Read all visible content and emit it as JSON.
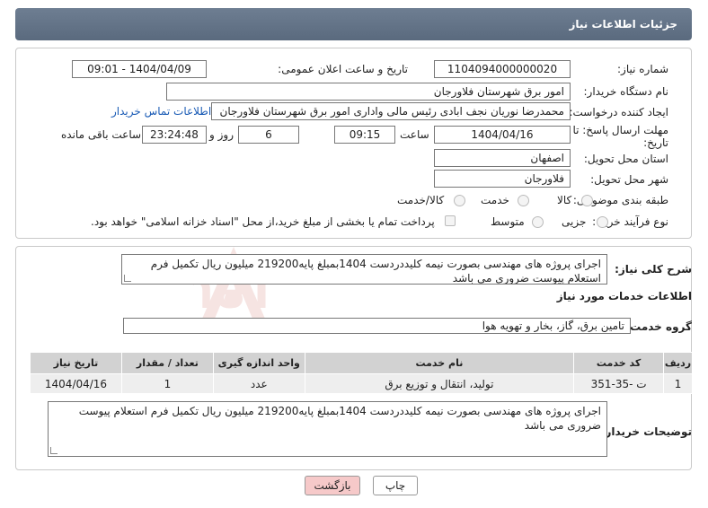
{
  "header": {
    "title": "جزئیات اطلاعات نیاز"
  },
  "form": {
    "need_number": {
      "label": "شماره نیاز:",
      "value": "1104094000000020"
    },
    "announce_date": {
      "label": "تاریخ و ساعت اعلان عمومی:",
      "value": "1404/04/09 - 09:01"
    },
    "buyer_org": {
      "label": "نام دستگاه خریدار:",
      "value": "امور برق شهرستان فلاورجان"
    },
    "requester": {
      "label": "ایجاد کننده درخواست:",
      "value": "محمدرضا نوریان نجف ابادی رئیس مالی واداری  امور برق شهرستان فلاورجان",
      "contact_link": "اطلاعات تماس خریدار"
    },
    "deadline": {
      "label_line1": "مهلت ارسال پاسخ: تا",
      "label_line2": "تاریخ:",
      "date": "1404/04/16",
      "time_label": "ساعت",
      "time": "09:15",
      "days": "6",
      "days_label": "روز و",
      "remaining": "23:24:48",
      "remaining_label": "ساعت باقی مانده"
    },
    "province": {
      "label": "استان محل تحویل:",
      "value": "اصفهان"
    },
    "city": {
      "label": "شهر محل تحویل:",
      "value": "فلاورجان"
    },
    "category": {
      "label": "طبقه بندی موضوعی:",
      "options": [
        "کالا",
        "خدمت",
        "کالا/خدمت"
      ],
      "selected": "خدمت"
    },
    "process": {
      "label": "نوع فرآیند خرید :",
      "options": [
        "جزیی",
        "متوسط"
      ],
      "selected": "جزیی",
      "payment_note": "پرداخت تمام یا بخشی از مبلغ خرید،از محل \"اسناد خزانه اسلامی\" خواهد بود."
    }
  },
  "details": {
    "summary_label": "شرح کلی نیاز:",
    "summary": "اجرای پروژه های مهندسی بصورت نیمه کلیددردست 1404بمبلغ پایه219200 میلیون ریال تکمیل فرم استعلام پیوست ضروری می باشد",
    "services_title": "اطلاعات خدمات مورد نیاز",
    "service_group_label": "گروه خدمت:",
    "service_group": "تامین برق، گاز، بخار و تهویه هوا",
    "table": {
      "headers": [
        "ردیف",
        "کد خدمت",
        "نام خدمت",
        "واحد اندازه گیری",
        "تعداد / مقدار",
        "تاریخ نیاز"
      ],
      "rows": [
        [
          "1",
          "ت -35-351",
          "تولید، انتقال و توزیع برق",
          "عدد",
          "1",
          "1404/04/16"
        ]
      ]
    },
    "buyer_notes_label": "توضیحات خریدار:",
    "buyer_notes": "اجرای پروژه های مهندسی بصورت نیمه کلیددردست 1404بمبلغ پایه219200 میلیون ریال تکمیل فرم استعلام پیوست ضروری می باشد"
  },
  "buttons": {
    "print": "چاپ",
    "back": "بازگشت"
  },
  "watermark": {
    "text": "AriaTender.neT"
  },
  "colors": {
    "header": "#64748a",
    "link": "#1a5bb5",
    "back_button": "#f6c9c9",
    "table_header": "#d2d2d2",
    "table_row": "#eeeeee"
  }
}
